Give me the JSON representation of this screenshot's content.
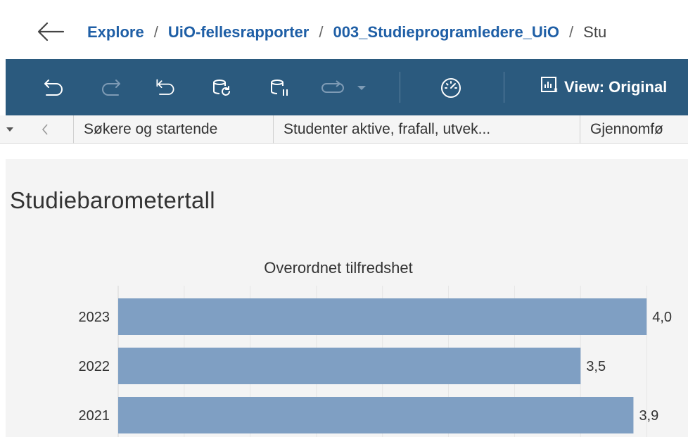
{
  "breadcrumb": {
    "items": [
      "Explore",
      "UiO-fellesrapporter",
      "003_Studieprogramledere_UiO"
    ],
    "current": "Stu",
    "separator": "/"
  },
  "toolbar": {
    "icons": [
      "undo-icon",
      "redo-icon",
      "revert-icon",
      "refresh-data-icon",
      "pause-updates-icon",
      "replay-icon",
      "replay-dropdown-icon",
      "metrics-icon",
      "view-icon"
    ],
    "view_label": "View: Original"
  },
  "tabs": [
    "Søkere og startende",
    "Studenter aktive, frafall, utvek...",
    "Gjennomfø"
  ],
  "dashboard": {
    "title": "Studiebarometertall"
  },
  "chart_data": {
    "type": "bar",
    "orientation": "horizontal",
    "title": "Overordnet tilfredshet",
    "categories": [
      "2023",
      "2022",
      "2021"
    ],
    "values": [
      4.0,
      3.5,
      3.9
    ],
    "value_labels": [
      "4,0",
      "3,5",
      "3,9"
    ],
    "xlim": [
      0,
      4.1
    ],
    "grid": true,
    "bar_color": "#7f9fc3"
  },
  "colors": {
    "toolbar_bg": "#2b5a7e",
    "link": "#1f5fa6",
    "dashboard_bg": "#f4f4f4"
  }
}
